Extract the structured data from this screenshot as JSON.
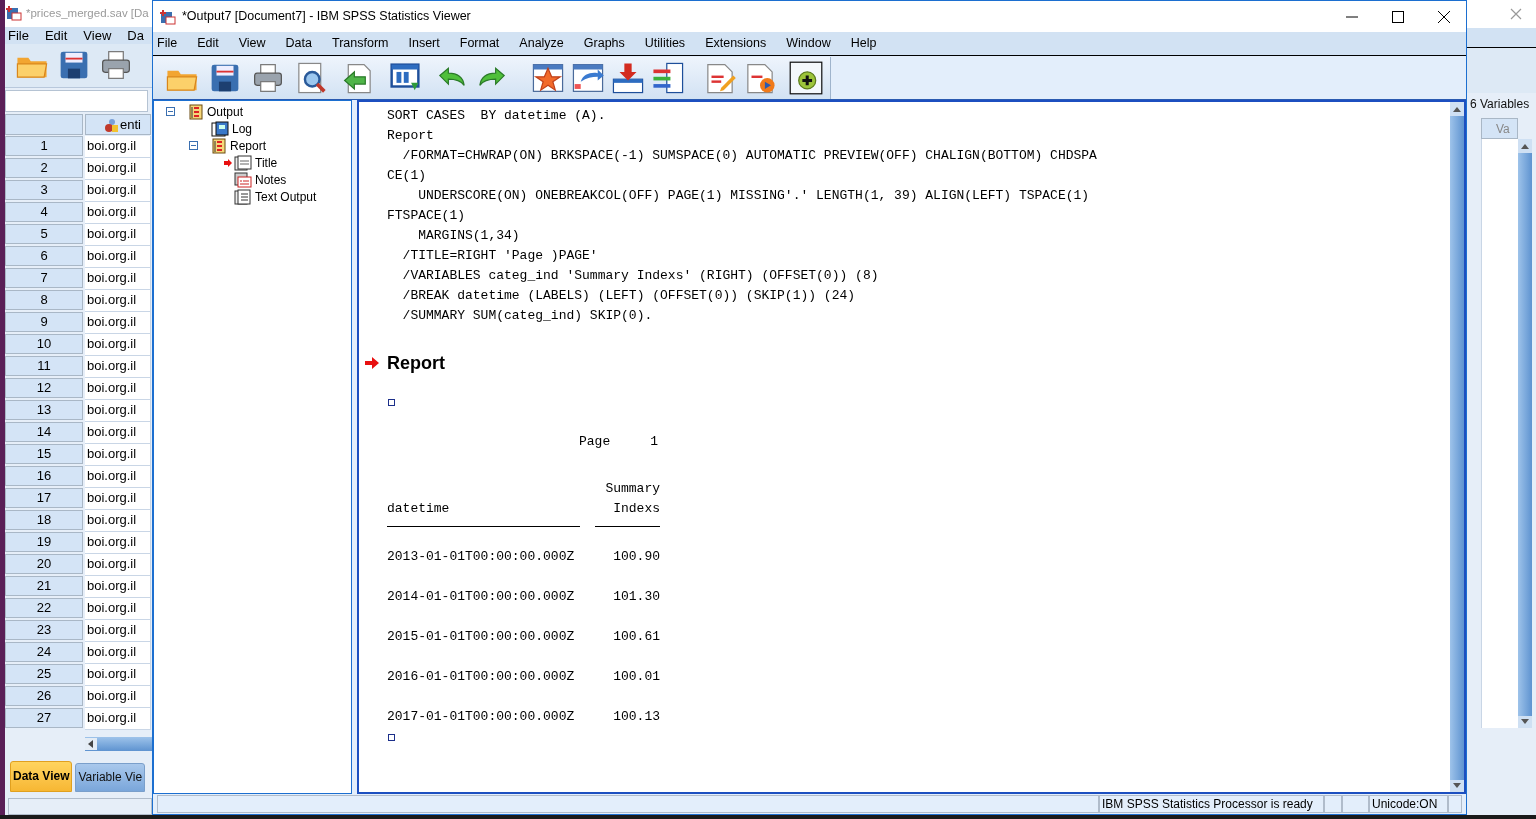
{
  "data_editor": {
    "title": "*prices_merged.sav [Da",
    "menu": [
      "File",
      "Edit",
      "View",
      "Da"
    ],
    "column_header": "enti",
    "column_2_header": "Va",
    "variables_count": "6 Variables",
    "rows": [
      {
        "number": "1",
        "value": "boi.org.il"
      },
      {
        "number": "2",
        "value": "boi.org.il"
      },
      {
        "number": "3",
        "value": "boi.org.il"
      },
      {
        "number": "4",
        "value": "boi.org.il"
      },
      {
        "number": "5",
        "value": "boi.org.il"
      },
      {
        "number": "6",
        "value": "boi.org.il"
      },
      {
        "number": "7",
        "value": "boi.org.il"
      },
      {
        "number": "8",
        "value": "boi.org.il"
      },
      {
        "number": "9",
        "value": "boi.org.il"
      },
      {
        "number": "10",
        "value": "boi.org.il"
      },
      {
        "number": "11",
        "value": "boi.org.il"
      },
      {
        "number": "12",
        "value": "boi.org.il"
      },
      {
        "number": "13",
        "value": "boi.org.il"
      },
      {
        "number": "14",
        "value": "boi.org.il"
      },
      {
        "number": "15",
        "value": "boi.org.il"
      },
      {
        "number": "16",
        "value": "boi.org.il"
      },
      {
        "number": "17",
        "value": "boi.org.il"
      },
      {
        "number": "18",
        "value": "boi.org.il"
      },
      {
        "number": "19",
        "value": "boi.org.il"
      },
      {
        "number": "20",
        "value": "boi.org.il"
      },
      {
        "number": "21",
        "value": "boi.org.il"
      },
      {
        "number": "22",
        "value": "boi.org.il"
      },
      {
        "number": "23",
        "value": "boi.org.il"
      },
      {
        "number": "24",
        "value": "boi.org.il"
      },
      {
        "number": "25",
        "value": "boi.org.il"
      },
      {
        "number": "26",
        "value": "boi.org.il"
      },
      {
        "number": "27",
        "value": "boi.org.il"
      }
    ],
    "tabs": [
      {
        "label": "Data View",
        "selected": true
      },
      {
        "label": "Variable Vie",
        "selected": false
      }
    ]
  },
  "viewer": {
    "title": "*Output7 [Document7] - IBM SPSS Statistics Viewer",
    "menu": [
      "File",
      "Edit",
      "View",
      "Data",
      "Transform",
      "Insert",
      "Format",
      "Analyze",
      "Graphs",
      "Utilities",
      "Extensions",
      "Window",
      "Help"
    ],
    "outline": [
      {
        "label": "Output",
        "kind": "heading",
        "expanded": true,
        "current": false,
        "children": [
          {
            "label": "Log",
            "kind": "log",
            "current": false
          },
          {
            "label": "Report",
            "kind": "heading",
            "expanded": true,
            "current": false,
            "children": [
              {
                "label": "Title",
                "kind": "title",
                "current": true
              },
              {
                "label": "Notes",
                "kind": "notes",
                "current": false
              },
              {
                "label": "Text Output",
                "kind": "text",
                "current": false
              }
            ]
          }
        ]
      }
    ],
    "syntax": [
      "SORT CASES  BY datetime (A).",
      "Report",
      "  /FORMAT=CHWRAP(ON) BRKSPACE(-1) SUMSPACE(0) AUTOMATIC PREVIEW(OFF) CHALIGN(BOTTOM) CHDSPA",
      "CE(1)",
      "    UNDERSCORE(ON) ONEBREAKCOL(OFF) PAGE(1) MISSING'.' LENGTH(1, 39) ALIGN(LEFT) TSPACE(1)",
      "FTSPACE(1)",
      "    MARGINS(1,34)",
      "  /TITLE=RIGHT 'Page )PAGE'",
      "  /VARIABLES categ_ind 'Summary Indexs' (RIGHT) (OFFSET(0)) (8)",
      "  /BREAK datetime (LABELS) (LEFT) (OFFSET(0)) (SKIP(1)) (24)",
      "  /SUMMARY SUM(categ_ind) SKIP(0)."
    ],
    "report": {
      "heading": "Report",
      "page_label": "Page",
      "page_number": "1",
      "columns": [
        "datetime",
        "Summary Indexs"
      ],
      "rows": [
        [
          "2013-01-01T00:00:00.000Z",
          "100.90"
        ],
        [
          "2014-01-01T00:00:00.000Z",
          "101.30"
        ],
        [
          "2015-01-01T00:00:00.000Z",
          "100.61"
        ],
        [
          "2016-01-01T00:00:00.000Z",
          "100.01"
        ],
        [
          "2017-01-01T00:00:00.000Z",
          "100.13"
        ]
      ]
    },
    "status_bar": [
      "IBM SPSS Statistics Processor is ready",
      "Unicode:ON"
    ]
  }
}
